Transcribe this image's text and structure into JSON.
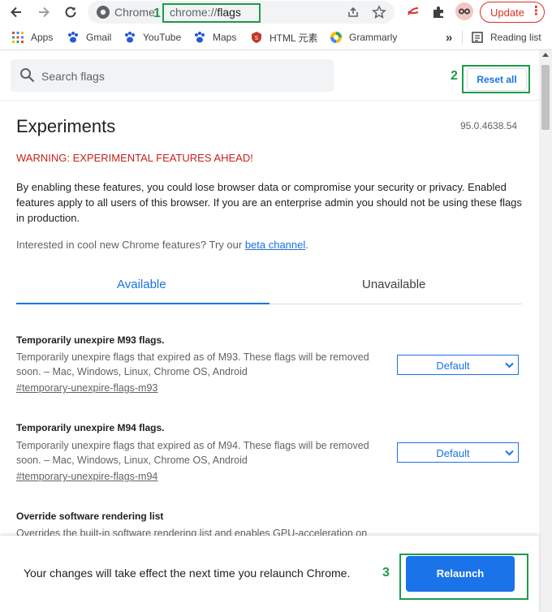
{
  "toolbar": {
    "site_label": "Chrome",
    "url_scheme": "chrome://",
    "url_path": "flags",
    "update_label": "Update",
    "menu_dots": "⋮"
  },
  "bookmarks": [
    {
      "label": "Apps",
      "icon": "apps-grid-icon"
    },
    {
      "label": "Gmail",
      "icon": "paw-icon"
    },
    {
      "label": "YouTube",
      "icon": "paw-icon"
    },
    {
      "label": "Maps",
      "icon": "paw-icon"
    },
    {
      "label": "HTML 元素",
      "icon": "html-shield-icon"
    },
    {
      "label": "Grammarly",
      "icon": "grammarly-icon"
    }
  ],
  "bookmarks_overflow": "»",
  "reading_list": "Reading list",
  "search": {
    "placeholder": "Search flags"
  },
  "reset_all": "Reset all",
  "page": {
    "title": "Experiments",
    "version": "95.0.4638.54",
    "warning": "WARNING: EXPERIMENTAL FEATURES AHEAD!",
    "intro": "By enabling these features, you could lose browser data or compromise your security or privacy. Enabled features apply to all users of this browser. If you are an enterprise admin you should not be using these flags in production.",
    "interested_prefix": "Interested in cool new Chrome features? Try our ",
    "beta_link": "beta channel",
    "interested_suffix": "."
  },
  "tabs": {
    "available": "Available",
    "unavailable": "Unavailable"
  },
  "experiments": [
    {
      "title": "Temporarily unexpire M93 flags.",
      "desc": "Temporarily unexpire flags that expired as of M93. These flags will be removed soon. – Mac, Windows, Linux, Chrome OS, Android",
      "link": "#temporary-unexpire-flags-m93",
      "value": "Default"
    },
    {
      "title": "Temporarily unexpire M94 flags.",
      "desc": "Temporarily unexpire flags that expired as of M94. These flags will be removed soon. – Mac, Windows, Linux, Chrome OS, Android",
      "link": "#temporary-unexpire-flags-m94",
      "value": "Default"
    },
    {
      "title": "Override software rendering list",
      "desc": "Overrides the built-in software rendering list and enables GPU-acceleration on",
      "link": "",
      "value": ""
    }
  ],
  "relaunch": {
    "message": "Your changes will take effect the next time you relaunch Chrome.",
    "button": "Relaunch"
  },
  "annotations": {
    "one": "1",
    "two": "2",
    "three": "3"
  },
  "colors": {
    "accent": "#1a73e8",
    "warning": "#c5221f",
    "annotation": "#1e9b4a"
  }
}
